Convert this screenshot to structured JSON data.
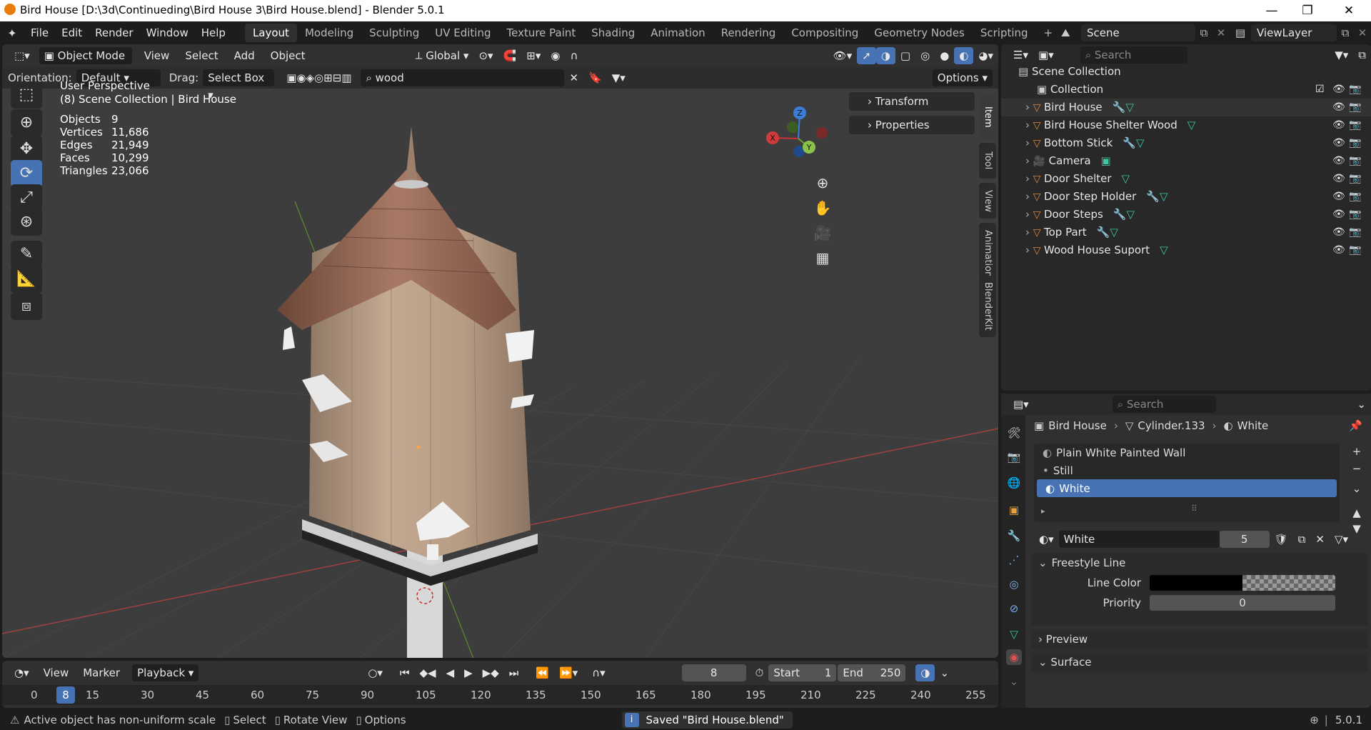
{
  "window": {
    "title": "Bird House [D:\\3d\\Continueding\\Bird House 3\\Bird House.blend] - Blender 5.0.1",
    "minimize": "—",
    "maximize": "❐",
    "close": "✕"
  },
  "menu": [
    "File",
    "Edit",
    "Render",
    "Window",
    "Help"
  ],
  "workspaces": [
    "Layout",
    "Modeling",
    "Sculpting",
    "UV Editing",
    "Texture Paint",
    "Shading",
    "Animation",
    "Rendering",
    "Compositing",
    "Geometry Nodes",
    "Scripting"
  ],
  "workspace_add": "+",
  "scene": "Scene",
  "viewlayer": "ViewLayer",
  "viewport": {
    "mode": "Object Mode",
    "menus": [
      "View",
      "Select",
      "Add",
      "Object"
    ],
    "transform_orientation": "Global",
    "orientation_label": "Orientation:",
    "orientation_value": "Default",
    "drag_label": "Drag:",
    "drag_value": "Select Box",
    "search_value": "wood",
    "options": "Options",
    "overlay_title": "User Perspective",
    "overlay_sub": "(8) Scene Collection | Bird House",
    "stats": [
      [
        "Objects",
        "9"
      ],
      [
        "Vertices",
        "11,686"
      ],
      [
        "Edges",
        "21,949"
      ],
      [
        "Faces",
        "10,299"
      ],
      [
        "Triangles",
        "23,066"
      ]
    ],
    "panels": [
      "Transform",
      "Properties"
    ],
    "side_tabs": [
      "Item",
      "Tool",
      "View",
      "Animation",
      "BlenderKit"
    ],
    "gizmo": {
      "x": "X",
      "y": "Y",
      "z": "Z"
    }
  },
  "outliner": {
    "search_placeholder": "Search",
    "root": "Scene Collection",
    "collection": "Collection",
    "items": [
      "Bird House",
      "Bird House Shelter Wood",
      "Bottom Stick",
      "Camera",
      "Door Shelter",
      "Door Step Holder",
      "Door Steps",
      "Top Part",
      "Wood House Suport"
    ]
  },
  "properties": {
    "search_placeholder": "Search",
    "breadcrumb": [
      "Bird House",
      "Cylinder.133",
      "White"
    ],
    "slots": [
      "Plain White Painted Wall",
      "Still",
      "White"
    ],
    "material_name": "White",
    "users": "5",
    "sections": {
      "freestyle": "Freestyle Line",
      "line_color_label": "Line Color",
      "priority_label": "Priority",
      "priority_value": "0",
      "preview": "Preview",
      "surface": "Surface"
    }
  },
  "timeline": {
    "menus": [
      "View",
      "Marker",
      "Playback"
    ],
    "current_frame": "8",
    "start_label": "Start",
    "start": "1",
    "end_label": "End",
    "end": "250",
    "ticks": [
      "0",
      "15",
      "30",
      "45",
      "60",
      "75",
      "90",
      "105",
      "120",
      "135",
      "150",
      "165",
      "180",
      "195",
      "210",
      "225",
      "240",
      "255"
    ],
    "playhead": "8"
  },
  "status": {
    "warning": "Active object has non-uniform scale",
    "select": "Select",
    "rotate": "Rotate View",
    "options": "Options",
    "saved": "Saved \"Bird House.blend\"",
    "version": "5.0.1"
  },
  "colors": {
    "accent": "#4772b3",
    "orange": "#e87d0d",
    "wood": "#b59a80",
    "roof": "#8a5a45"
  }
}
